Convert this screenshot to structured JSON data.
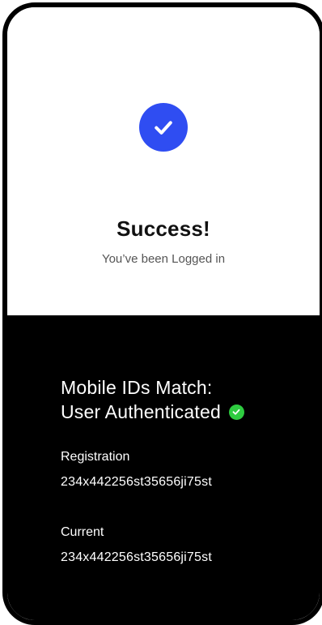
{
  "success": {
    "title": "Success!",
    "subtitle": "You’ve been Logged in",
    "icon": "check-circle-icon",
    "accent_color": "#2f4df2"
  },
  "auth": {
    "line1": "Mobile IDs Match:",
    "line2": "User Authenticated",
    "icon": "check-badge-icon",
    "status_color": "#2ecc40"
  },
  "registration": {
    "label": "Registration",
    "value": "234x442256st35656ji75st"
  },
  "current": {
    "label": "Current",
    "value": "234x442256st35656ji75st"
  }
}
